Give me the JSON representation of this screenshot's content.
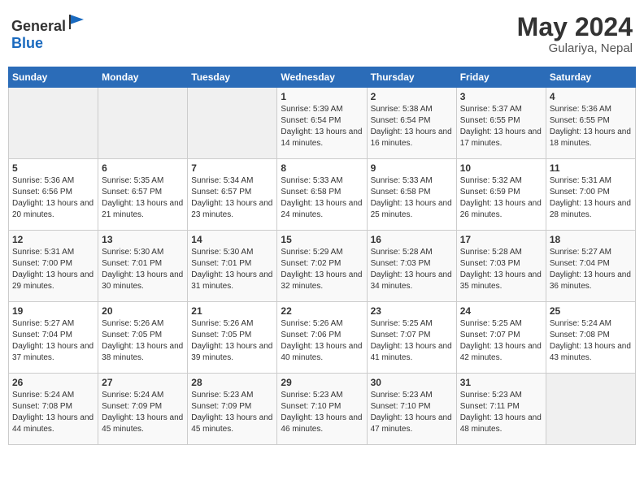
{
  "header": {
    "logo_general": "General",
    "logo_blue": "Blue",
    "month_year": "May 2024",
    "location": "Gulariya, Nepal"
  },
  "weekdays": [
    "Sunday",
    "Monday",
    "Tuesday",
    "Wednesday",
    "Thursday",
    "Friday",
    "Saturday"
  ],
  "weeks": [
    [
      {
        "day": "",
        "sunrise": "",
        "sunset": "",
        "daylight": ""
      },
      {
        "day": "",
        "sunrise": "",
        "sunset": "",
        "daylight": ""
      },
      {
        "day": "",
        "sunrise": "",
        "sunset": "",
        "daylight": ""
      },
      {
        "day": "1",
        "sunrise": "Sunrise: 5:39 AM",
        "sunset": "Sunset: 6:54 PM",
        "daylight": "Daylight: 13 hours and 14 minutes."
      },
      {
        "day": "2",
        "sunrise": "Sunrise: 5:38 AM",
        "sunset": "Sunset: 6:54 PM",
        "daylight": "Daylight: 13 hours and 16 minutes."
      },
      {
        "day": "3",
        "sunrise": "Sunrise: 5:37 AM",
        "sunset": "Sunset: 6:55 PM",
        "daylight": "Daylight: 13 hours and 17 minutes."
      },
      {
        "day": "4",
        "sunrise": "Sunrise: 5:36 AM",
        "sunset": "Sunset: 6:55 PM",
        "daylight": "Daylight: 13 hours and 18 minutes."
      }
    ],
    [
      {
        "day": "5",
        "sunrise": "Sunrise: 5:36 AM",
        "sunset": "Sunset: 6:56 PM",
        "daylight": "Daylight: 13 hours and 20 minutes."
      },
      {
        "day": "6",
        "sunrise": "Sunrise: 5:35 AM",
        "sunset": "Sunset: 6:57 PM",
        "daylight": "Daylight: 13 hours and 21 minutes."
      },
      {
        "day": "7",
        "sunrise": "Sunrise: 5:34 AM",
        "sunset": "Sunset: 6:57 PM",
        "daylight": "Daylight: 13 hours and 23 minutes."
      },
      {
        "day": "8",
        "sunrise": "Sunrise: 5:33 AM",
        "sunset": "Sunset: 6:58 PM",
        "daylight": "Daylight: 13 hours and 24 minutes."
      },
      {
        "day": "9",
        "sunrise": "Sunrise: 5:33 AM",
        "sunset": "Sunset: 6:58 PM",
        "daylight": "Daylight: 13 hours and 25 minutes."
      },
      {
        "day": "10",
        "sunrise": "Sunrise: 5:32 AM",
        "sunset": "Sunset: 6:59 PM",
        "daylight": "Daylight: 13 hours and 26 minutes."
      },
      {
        "day": "11",
        "sunrise": "Sunrise: 5:31 AM",
        "sunset": "Sunset: 7:00 PM",
        "daylight": "Daylight: 13 hours and 28 minutes."
      }
    ],
    [
      {
        "day": "12",
        "sunrise": "Sunrise: 5:31 AM",
        "sunset": "Sunset: 7:00 PM",
        "daylight": "Daylight: 13 hours and 29 minutes."
      },
      {
        "day": "13",
        "sunrise": "Sunrise: 5:30 AM",
        "sunset": "Sunset: 7:01 PM",
        "daylight": "Daylight: 13 hours and 30 minutes."
      },
      {
        "day": "14",
        "sunrise": "Sunrise: 5:30 AM",
        "sunset": "Sunset: 7:01 PM",
        "daylight": "Daylight: 13 hours and 31 minutes."
      },
      {
        "day": "15",
        "sunrise": "Sunrise: 5:29 AM",
        "sunset": "Sunset: 7:02 PM",
        "daylight": "Daylight: 13 hours and 32 minutes."
      },
      {
        "day": "16",
        "sunrise": "Sunrise: 5:28 AM",
        "sunset": "Sunset: 7:03 PM",
        "daylight": "Daylight: 13 hours and 34 minutes."
      },
      {
        "day": "17",
        "sunrise": "Sunrise: 5:28 AM",
        "sunset": "Sunset: 7:03 PM",
        "daylight": "Daylight: 13 hours and 35 minutes."
      },
      {
        "day": "18",
        "sunrise": "Sunrise: 5:27 AM",
        "sunset": "Sunset: 7:04 PM",
        "daylight": "Daylight: 13 hours and 36 minutes."
      }
    ],
    [
      {
        "day": "19",
        "sunrise": "Sunrise: 5:27 AM",
        "sunset": "Sunset: 7:04 PM",
        "daylight": "Daylight: 13 hours and 37 minutes."
      },
      {
        "day": "20",
        "sunrise": "Sunrise: 5:26 AM",
        "sunset": "Sunset: 7:05 PM",
        "daylight": "Daylight: 13 hours and 38 minutes."
      },
      {
        "day": "21",
        "sunrise": "Sunrise: 5:26 AM",
        "sunset": "Sunset: 7:05 PM",
        "daylight": "Daylight: 13 hours and 39 minutes."
      },
      {
        "day": "22",
        "sunrise": "Sunrise: 5:26 AM",
        "sunset": "Sunset: 7:06 PM",
        "daylight": "Daylight: 13 hours and 40 minutes."
      },
      {
        "day": "23",
        "sunrise": "Sunrise: 5:25 AM",
        "sunset": "Sunset: 7:07 PM",
        "daylight": "Daylight: 13 hours and 41 minutes."
      },
      {
        "day": "24",
        "sunrise": "Sunrise: 5:25 AM",
        "sunset": "Sunset: 7:07 PM",
        "daylight": "Daylight: 13 hours and 42 minutes."
      },
      {
        "day": "25",
        "sunrise": "Sunrise: 5:24 AM",
        "sunset": "Sunset: 7:08 PM",
        "daylight": "Daylight: 13 hours and 43 minutes."
      }
    ],
    [
      {
        "day": "26",
        "sunrise": "Sunrise: 5:24 AM",
        "sunset": "Sunset: 7:08 PM",
        "daylight": "Daylight: 13 hours and 44 minutes."
      },
      {
        "day": "27",
        "sunrise": "Sunrise: 5:24 AM",
        "sunset": "Sunset: 7:09 PM",
        "daylight": "Daylight: 13 hours and 45 minutes."
      },
      {
        "day": "28",
        "sunrise": "Sunrise: 5:23 AM",
        "sunset": "Sunset: 7:09 PM",
        "daylight": "Daylight: 13 hours and 45 minutes."
      },
      {
        "day": "29",
        "sunrise": "Sunrise: 5:23 AM",
        "sunset": "Sunset: 7:10 PM",
        "daylight": "Daylight: 13 hours and 46 minutes."
      },
      {
        "day": "30",
        "sunrise": "Sunrise: 5:23 AM",
        "sunset": "Sunset: 7:10 PM",
        "daylight": "Daylight: 13 hours and 47 minutes."
      },
      {
        "day": "31",
        "sunrise": "Sunrise: 5:23 AM",
        "sunset": "Sunset: 7:11 PM",
        "daylight": "Daylight: 13 hours and 48 minutes."
      },
      {
        "day": "",
        "sunrise": "",
        "sunset": "",
        "daylight": ""
      }
    ]
  ]
}
